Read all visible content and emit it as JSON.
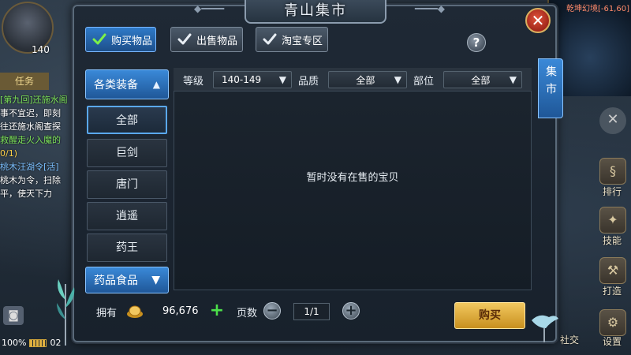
{
  "window": {
    "title": "青山集市"
  },
  "tabs": [
    {
      "label": "购买物品",
      "active": true
    },
    {
      "label": "出售物品",
      "active": false
    },
    {
      "label": "淘宝专区",
      "active": false
    }
  ],
  "help": {
    "glyph": "?"
  },
  "close": {
    "glyph": "✕"
  },
  "side_tab": {
    "label": "集市"
  },
  "categories": {
    "header": "各类装备",
    "items": [
      "全部",
      "巨剑",
      "唐门",
      "逍遥",
      "药王"
    ],
    "footer": "药品食品",
    "selected": "全部"
  },
  "filters": {
    "level_label": "等级",
    "level_value": "140-149",
    "quality_label": "品质",
    "quality_value": "全部",
    "slot_label": "部位",
    "slot_value": "全部"
  },
  "listing": {
    "empty_message": "暂时没有在售的宝贝"
  },
  "footer": {
    "owned_label": "拥有",
    "gold_amount": "96,676",
    "page_label": "页数",
    "page_value": "1/1",
    "buy_label": "购买"
  },
  "background": {
    "avatar_level": "140",
    "side_tab": "任务",
    "quest_lines": [
      "[第九回]还施水阁",
      "事不宜迟，即刻",
      "往还施水阁查探",
      "救醒走火入魔的",
      "0/1)",
      "桃木汪湖令[活]",
      "桃木为令，扫除",
      "平，使天下力"
    ],
    "map_label": "乾坤幻境[-61,60]",
    "battery_text": "100%",
    "time_text": "02",
    "right_buttons": [
      "排行",
      "技能",
      "打造",
      "社交",
      "设置"
    ]
  },
  "colors": {
    "tab_active": "#2f7ac8",
    "buy_button": "#e0aa3a",
    "plus": "#4ce04a",
    "close": "#c8351f"
  }
}
